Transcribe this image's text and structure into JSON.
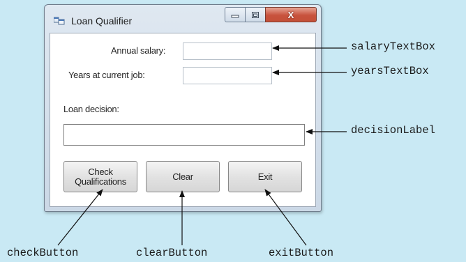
{
  "window": {
    "title": "Loan Qualifier",
    "close_symbol": "X"
  },
  "form": {
    "salary_label": "Annual salary:",
    "salary_value": "",
    "years_label": "Years at current job:",
    "years_value": "",
    "decision_caption": "Loan decision:",
    "decision_value": ""
  },
  "buttons": {
    "check_label": "Check\nQualifications",
    "clear_label": "Clear",
    "exit_label": "Exit"
  },
  "callouts": {
    "salary": "salaryTextBox",
    "years": "yearsTextBox",
    "decision": "decisionLabel",
    "check": "checkButton",
    "clear": "clearButton",
    "exit": "exitButton"
  },
  "colors": {
    "background": "#c9e9f4",
    "close_button": "#c8523d"
  }
}
